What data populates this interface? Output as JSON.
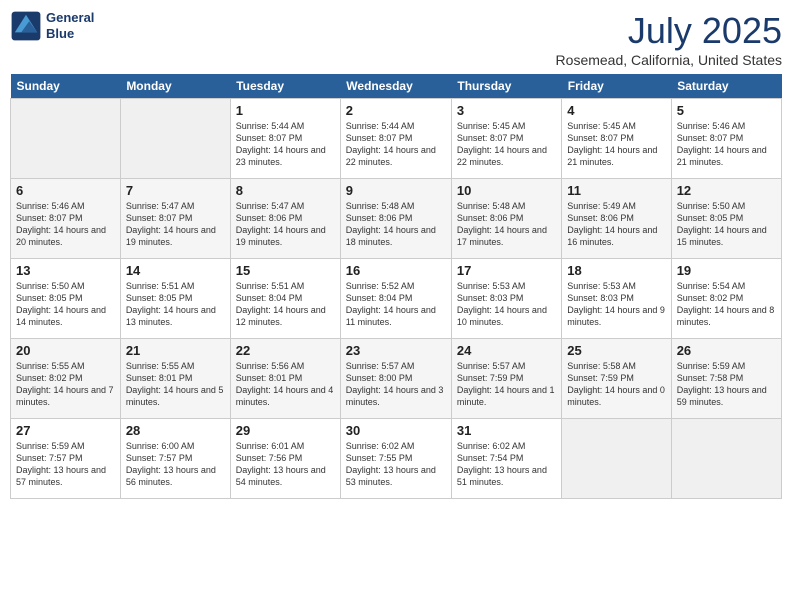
{
  "header": {
    "logo_line1": "General",
    "logo_line2": "Blue",
    "month": "July 2025",
    "location": "Rosemead, California, United States"
  },
  "days_of_week": [
    "Sunday",
    "Monday",
    "Tuesday",
    "Wednesday",
    "Thursday",
    "Friday",
    "Saturday"
  ],
  "weeks": [
    [
      {
        "day": "",
        "info": ""
      },
      {
        "day": "",
        "info": ""
      },
      {
        "day": "1",
        "info": "Sunrise: 5:44 AM\nSunset: 8:07 PM\nDaylight: 14 hours and 23 minutes."
      },
      {
        "day": "2",
        "info": "Sunrise: 5:44 AM\nSunset: 8:07 PM\nDaylight: 14 hours and 22 minutes."
      },
      {
        "day": "3",
        "info": "Sunrise: 5:45 AM\nSunset: 8:07 PM\nDaylight: 14 hours and 22 minutes."
      },
      {
        "day": "4",
        "info": "Sunrise: 5:45 AM\nSunset: 8:07 PM\nDaylight: 14 hours and 21 minutes."
      },
      {
        "day": "5",
        "info": "Sunrise: 5:46 AM\nSunset: 8:07 PM\nDaylight: 14 hours and 21 minutes."
      }
    ],
    [
      {
        "day": "6",
        "info": "Sunrise: 5:46 AM\nSunset: 8:07 PM\nDaylight: 14 hours and 20 minutes."
      },
      {
        "day": "7",
        "info": "Sunrise: 5:47 AM\nSunset: 8:07 PM\nDaylight: 14 hours and 19 minutes."
      },
      {
        "day": "8",
        "info": "Sunrise: 5:47 AM\nSunset: 8:06 PM\nDaylight: 14 hours and 19 minutes."
      },
      {
        "day": "9",
        "info": "Sunrise: 5:48 AM\nSunset: 8:06 PM\nDaylight: 14 hours and 18 minutes."
      },
      {
        "day": "10",
        "info": "Sunrise: 5:48 AM\nSunset: 8:06 PM\nDaylight: 14 hours and 17 minutes."
      },
      {
        "day": "11",
        "info": "Sunrise: 5:49 AM\nSunset: 8:06 PM\nDaylight: 14 hours and 16 minutes."
      },
      {
        "day": "12",
        "info": "Sunrise: 5:50 AM\nSunset: 8:05 PM\nDaylight: 14 hours and 15 minutes."
      }
    ],
    [
      {
        "day": "13",
        "info": "Sunrise: 5:50 AM\nSunset: 8:05 PM\nDaylight: 14 hours and 14 minutes."
      },
      {
        "day": "14",
        "info": "Sunrise: 5:51 AM\nSunset: 8:05 PM\nDaylight: 14 hours and 13 minutes."
      },
      {
        "day": "15",
        "info": "Sunrise: 5:51 AM\nSunset: 8:04 PM\nDaylight: 14 hours and 12 minutes."
      },
      {
        "day": "16",
        "info": "Sunrise: 5:52 AM\nSunset: 8:04 PM\nDaylight: 14 hours and 11 minutes."
      },
      {
        "day": "17",
        "info": "Sunrise: 5:53 AM\nSunset: 8:03 PM\nDaylight: 14 hours and 10 minutes."
      },
      {
        "day": "18",
        "info": "Sunrise: 5:53 AM\nSunset: 8:03 PM\nDaylight: 14 hours and 9 minutes."
      },
      {
        "day": "19",
        "info": "Sunrise: 5:54 AM\nSunset: 8:02 PM\nDaylight: 14 hours and 8 minutes."
      }
    ],
    [
      {
        "day": "20",
        "info": "Sunrise: 5:55 AM\nSunset: 8:02 PM\nDaylight: 14 hours and 7 minutes."
      },
      {
        "day": "21",
        "info": "Sunrise: 5:55 AM\nSunset: 8:01 PM\nDaylight: 14 hours and 5 minutes."
      },
      {
        "day": "22",
        "info": "Sunrise: 5:56 AM\nSunset: 8:01 PM\nDaylight: 14 hours and 4 minutes."
      },
      {
        "day": "23",
        "info": "Sunrise: 5:57 AM\nSunset: 8:00 PM\nDaylight: 14 hours and 3 minutes."
      },
      {
        "day": "24",
        "info": "Sunrise: 5:57 AM\nSunset: 7:59 PM\nDaylight: 14 hours and 1 minute."
      },
      {
        "day": "25",
        "info": "Sunrise: 5:58 AM\nSunset: 7:59 PM\nDaylight: 14 hours and 0 minutes."
      },
      {
        "day": "26",
        "info": "Sunrise: 5:59 AM\nSunset: 7:58 PM\nDaylight: 13 hours and 59 minutes."
      }
    ],
    [
      {
        "day": "27",
        "info": "Sunrise: 5:59 AM\nSunset: 7:57 PM\nDaylight: 13 hours and 57 minutes."
      },
      {
        "day": "28",
        "info": "Sunrise: 6:00 AM\nSunset: 7:57 PM\nDaylight: 13 hours and 56 minutes."
      },
      {
        "day": "29",
        "info": "Sunrise: 6:01 AM\nSunset: 7:56 PM\nDaylight: 13 hours and 54 minutes."
      },
      {
        "day": "30",
        "info": "Sunrise: 6:02 AM\nSunset: 7:55 PM\nDaylight: 13 hours and 53 minutes."
      },
      {
        "day": "31",
        "info": "Sunrise: 6:02 AM\nSunset: 7:54 PM\nDaylight: 13 hours and 51 minutes."
      },
      {
        "day": "",
        "info": ""
      },
      {
        "day": "",
        "info": ""
      }
    ]
  ]
}
